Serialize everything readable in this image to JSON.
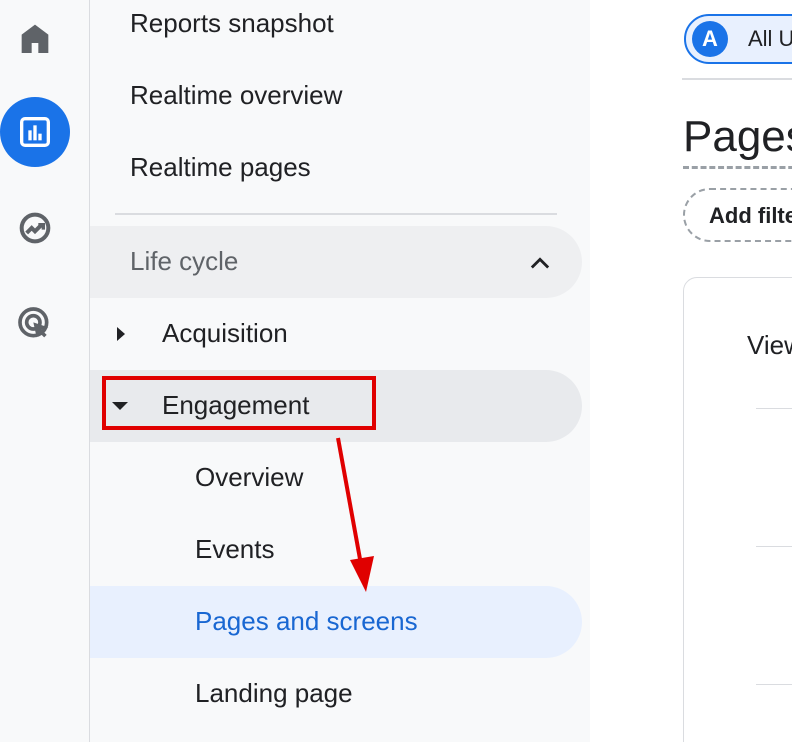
{
  "rail": {
    "items": [
      {
        "icon": "home-icon"
      },
      {
        "icon": "reports-icon",
        "active": true
      },
      {
        "icon": "explore-icon"
      },
      {
        "icon": "advertising-icon"
      }
    ],
    "accent": "#1a73e8"
  },
  "nav": {
    "top_items": [
      "Reports snapshot",
      "Realtime overview",
      "Realtime pages"
    ],
    "section": "Life cycle",
    "acquisition": "Acquisition",
    "engagement": "Engagement",
    "engagement_items": [
      "Overview",
      "Events",
      "Pages and screens",
      "Landing page"
    ],
    "selected": "Pages and screens"
  },
  "main": {
    "audience_avatar": "A",
    "audience_label": "All U",
    "title": "Pages",
    "add_filter": "Add filte",
    "card_label": "View"
  },
  "annotation": {
    "color": "#e00000"
  }
}
